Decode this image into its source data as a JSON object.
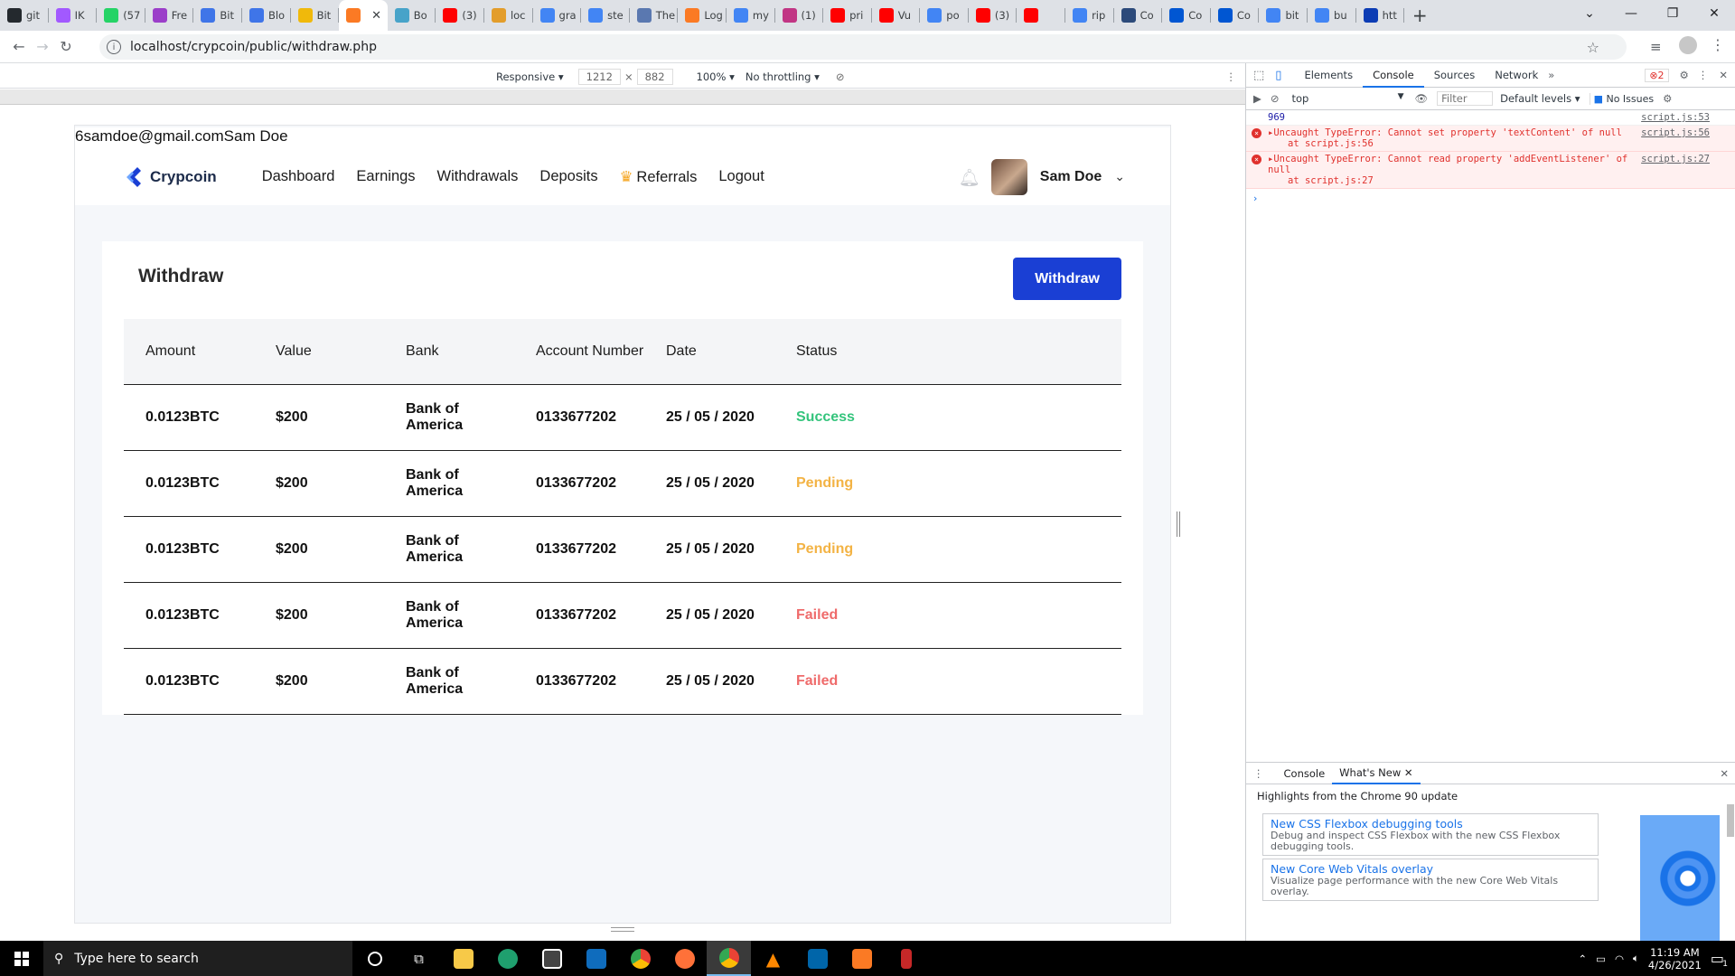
{
  "browser": {
    "tabs": [
      {
        "label": "git",
        "icon": "github-icon",
        "color": "#24292e"
      },
      {
        "label": "IK",
        "icon": "figma-icon",
        "color": "#a259ff"
      },
      {
        "label": "(57",
        "icon": "whatsapp-icon",
        "color": "#25d366"
      },
      {
        "label": "Fre",
        "icon": "app-icon",
        "color": "#9b3ec9"
      },
      {
        "label": "Bit",
        "icon": "binance-icon",
        "color": "#3f75e8"
      },
      {
        "label": "Blo",
        "icon": "binance-icon",
        "color": "#3f75e8"
      },
      {
        "label": "Bit",
        "icon": "bitcoin-icon",
        "color": "#f0b90b"
      },
      {
        "label": "",
        "icon": "xampp-icon",
        "color": "#fb7a24"
      },
      {
        "label": "Bo",
        "icon": "web-icon",
        "color": "#47a3c9"
      },
      {
        "label": "(3)",
        "icon": "youtube-icon",
        "color": "#ff0000"
      },
      {
        "label": "loc",
        "icon": "web-icon",
        "color": "#e39d2b"
      },
      {
        "label": "gra",
        "icon": "google-icon",
        "color": "#4285f4"
      },
      {
        "label": "ste",
        "icon": "google-icon",
        "color": "#4285f4"
      },
      {
        "label": "The",
        "icon": "web-icon",
        "color": "#5a78b0"
      },
      {
        "label": "Log",
        "icon": "xampp-icon",
        "color": "#fb7a24"
      },
      {
        "label": "my",
        "icon": "google-icon",
        "color": "#4285f4"
      },
      {
        "label": "(1)",
        "icon": "instagram-icon",
        "color": "#c13584"
      },
      {
        "label": "pri",
        "icon": "youtube-icon",
        "color": "#ff0000"
      },
      {
        "label": "Vu",
        "icon": "youtube-icon",
        "color": "#ff0000"
      },
      {
        "label": "po",
        "icon": "google-icon",
        "color": "#4285f4"
      },
      {
        "label": "(3)",
        "icon": "youtube-icon",
        "color": "#ff0000"
      },
      {
        "label": "",
        "icon": "youtube-icon",
        "color": "#ff0000"
      },
      {
        "label": "rip",
        "icon": "google-icon",
        "color": "#4285f4"
      },
      {
        "label": "Co",
        "icon": "web-icon",
        "color": "#2c4a7a"
      },
      {
        "label": "Co",
        "icon": "coursera-icon",
        "color": "#0056d2"
      },
      {
        "label": "Co",
        "icon": "coursera-icon",
        "color": "#0056d2"
      },
      {
        "label": "bit",
        "icon": "google-icon",
        "color": "#4285f4"
      },
      {
        "label": "bu",
        "icon": "google-icon",
        "color": "#4285f4"
      },
      {
        "label": "htt",
        "icon": "web-icon",
        "color": "#0c3cb4"
      }
    ],
    "active_tab_index": 7,
    "url": "localhost/crypcoin/public/withdraw.php"
  },
  "device_toolbar": {
    "mode": "Responsive",
    "width": "1212",
    "height": "882",
    "zoom": "100%",
    "throttling": "No throttling"
  },
  "page": {
    "echo_text": "6samdoe@gmail.comSam Doe",
    "brand": "Crypcoin",
    "nav": [
      "Dashboard",
      "Earnings",
      "Withdrawals",
      "Deposits",
      "Referrals",
      "Logout"
    ],
    "user_name": "Sam Doe",
    "card_title": "Withdraw",
    "withdraw_button": "Withdraw",
    "table": {
      "headers": [
        "Amount",
        "Value",
        "Bank",
        "Account Number",
        "Date",
        "Status"
      ],
      "rows": [
        {
          "amount": "0.0123BTC",
          "value": "$200",
          "bank": "Bank of America",
          "account": "0133677202",
          "date": "25 / 05 / 2020",
          "status": "Success"
        },
        {
          "amount": "0.0123BTC",
          "value": "$200",
          "bank": "Bank of America",
          "account": "0133677202",
          "date": "25 / 05 / 2020",
          "status": "Pending"
        },
        {
          "amount": "0.0123BTC",
          "value": "$200",
          "bank": "Bank of America",
          "account": "0133677202",
          "date": "25 / 05 / 2020",
          "status": "Pending"
        },
        {
          "amount": "0.0123BTC",
          "value": "$200",
          "bank": "Bank of America",
          "account": "0133677202",
          "date": "25 / 05 / 2020",
          "status": "Failed"
        },
        {
          "amount": "0.0123BTC",
          "value": "$200",
          "bank": "Bank of America",
          "account": "0133677202",
          "date": "25 / 05 / 2020",
          "status": "Failed"
        }
      ]
    },
    "colors": {
      "primary": "#1a3fd4",
      "success": "#34c47c",
      "pending": "#f3b344",
      "failed": "#ef6b6b"
    }
  },
  "devtools": {
    "tabs": [
      "Elements",
      "Console",
      "Sources",
      "Network"
    ],
    "active_tab": "Console",
    "error_count": "2",
    "context": "top",
    "filter_placeholder": "Filter",
    "levels": "Default levels",
    "issues": "No Issues",
    "log": [
      {
        "type": "log",
        "text": "969",
        "source": "script.js:53"
      },
      {
        "type": "error",
        "text": "▸Uncaught TypeError: Cannot set property 'textContent' of null",
        "trace": "at script.js:56",
        "source": "script.js:56"
      },
      {
        "type": "error",
        "text": "▸Uncaught TypeError: Cannot read property 'addEventListener' of null",
        "trace": "at script.js:27",
        "source": "script.js:27"
      }
    ],
    "drawer": {
      "tabs": [
        "Console",
        "What's New"
      ],
      "highlight": "Highlights from the Chrome 90 update",
      "cards": [
        {
          "title": "New CSS Flexbox debugging tools",
          "desc": "Debug and inspect CSS Flexbox with the new CSS Flexbox debugging tools."
        },
        {
          "title": "New Core Web Vitals overlay",
          "desc": "Visualize page performance with the new Core Web Vitals overlay."
        }
      ]
    }
  },
  "taskbar": {
    "search_placeholder": "Type here to search",
    "time": "11:19 AM",
    "date": "4/26/2021",
    "notifications": "1"
  }
}
